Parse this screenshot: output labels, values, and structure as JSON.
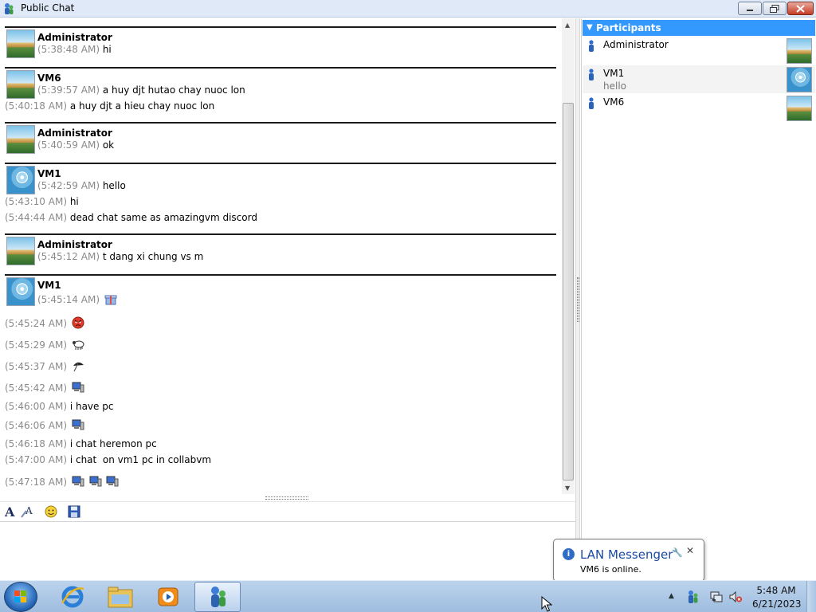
{
  "window": {
    "title": "Public Chat"
  },
  "messages": [
    {
      "sender": "Administrator",
      "avatar": "stairs-avatar",
      "lines": [
        {
          "time": "(5:38:48 AM)",
          "text": "hi"
        }
      ]
    },
    {
      "sender": "VM6",
      "avatar": "stairs-avatar",
      "lines": [
        {
          "time": "(5:39:57 AM)",
          "text": "a huy djt hutao chay nuoc lon"
        },
        {
          "time": "(5:40:18 AM)",
          "text": "a huy djt a hieu chay nuoc lon"
        }
      ]
    },
    {
      "sender": "Administrator",
      "avatar": "stairs-avatar",
      "lines": [
        {
          "time": "(5:40:59 AM)",
          "text": "ok"
        }
      ]
    },
    {
      "sender": "VM1",
      "avatar": "ferris-wheel-avatar",
      "lines": [
        {
          "time": "(5:42:59 AM)",
          "text": "hello"
        },
        {
          "time": "(5:43:10 AM)",
          "text": "hi"
        },
        {
          "time": "(5:44:44 AM)",
          "text": "dead chat same as amazingvm discord"
        }
      ]
    },
    {
      "sender": "Administrator",
      "avatar": "stairs-avatar",
      "lines": [
        {
          "time": "(5:45:12 AM)",
          "text": "t dang xi chung vs m"
        }
      ]
    },
    {
      "sender": "VM1",
      "avatar": "ferris-wheel-avatar",
      "lines": [
        {
          "time": "(5:45:14 AM)",
          "text": "",
          "emoticons": [
            "gift-emoticon"
          ]
        },
        {
          "time": "(5:45:24 AM)",
          "text": "",
          "emoticons": [
            "angry-face-emoticon"
          ]
        },
        {
          "time": "(5:45:29 AM)",
          "text": "",
          "emoticons": [
            "sheep-emoticon"
          ]
        },
        {
          "time": "(5:45:37 AM)",
          "text": "",
          "emoticons": [
            "umbrella-emoticon"
          ]
        },
        {
          "time": "(5:45:42 AM)",
          "text": "",
          "emoticons": [
            "computer-emoticon"
          ]
        },
        {
          "time": "(5:46:00 AM)",
          "text": "i have pc"
        },
        {
          "time": "(5:46:06 AM)",
          "text": "",
          "emoticons": [
            "computer-emoticon"
          ]
        },
        {
          "time": "(5:46:18 AM)",
          "text": "i chat heremon pc"
        },
        {
          "time": "(5:47:00 AM)",
          "text": "i chat  on vm1 pc in collabvm"
        },
        {
          "time": "(5:47:18 AM)",
          "text": "",
          "emoticons": [
            "computer-emoticon",
            "computer-emoticon",
            "computer-emoticon"
          ]
        }
      ]
    }
  ],
  "toolbar": {
    "icons": [
      "font-icon",
      "font-style-icon",
      "smiley-icon",
      "save-icon"
    ]
  },
  "input": {
    "value": ""
  },
  "participants": {
    "header": "Participants",
    "items": [
      {
        "name": "Administrator",
        "note": "",
        "avatar": "stairs-avatar"
      },
      {
        "name": "VM1",
        "note": "hello",
        "avatar": "ferris-wheel-avatar"
      },
      {
        "name": "VM6",
        "note": "",
        "avatar": "stairs-avatar"
      }
    ]
  },
  "notification": {
    "title": "LAN Messenger",
    "message": "VM6 is online."
  },
  "taskbar": {
    "apps": [
      "internet-explorer-icon",
      "file-explorer-icon",
      "media-player-icon",
      "lan-messenger-icon"
    ],
    "clock": {
      "time": "5:48 AM",
      "date": "6/21/2023"
    }
  },
  "colors": {
    "accent": "#3399ff",
    "timestamp": "#8a8a8a",
    "separator": "#1a1a1a"
  }
}
